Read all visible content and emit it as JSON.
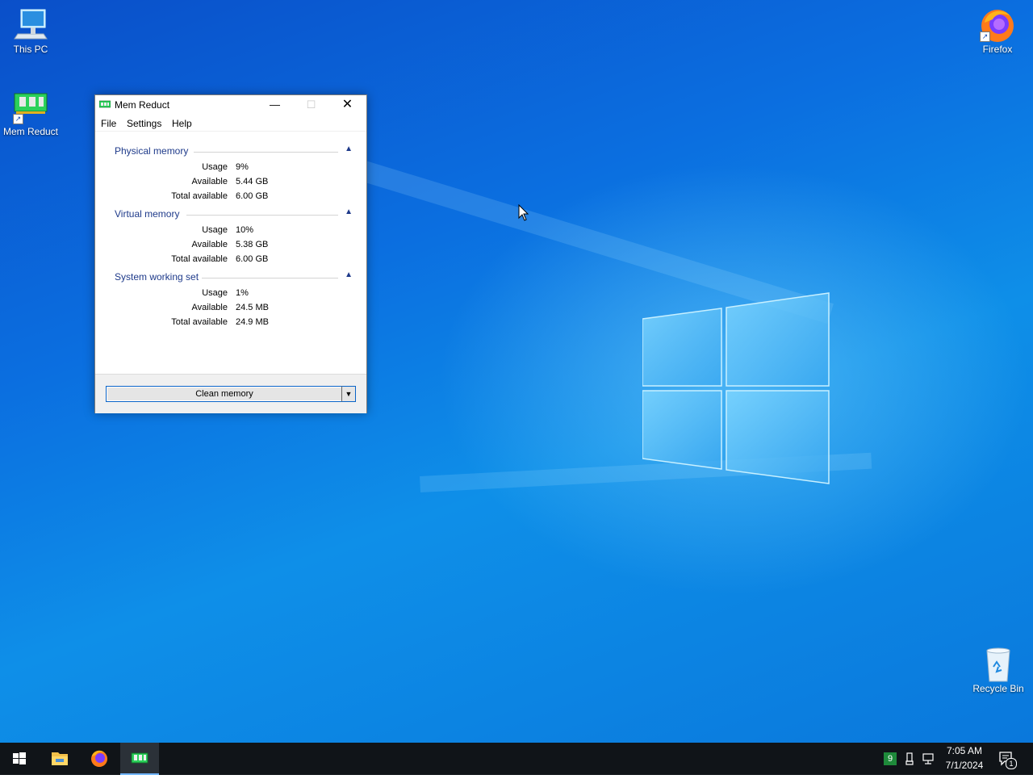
{
  "desktop": {
    "icons": {
      "this_pc": "This PC",
      "mem_reduct": "Mem Reduct",
      "firefox": "Firefox",
      "recycle_bin": "Recycle Bin"
    }
  },
  "window": {
    "title": "Mem Reduct",
    "menu": {
      "file": "File",
      "settings": "Settings",
      "help": "Help"
    },
    "groups": [
      {
        "name": "Physical memory",
        "rows": [
          {
            "label": "Usage",
            "value": "9%"
          },
          {
            "label": "Available",
            "value": "5.44 GB"
          },
          {
            "label": "Total available",
            "value": "6.00 GB"
          }
        ]
      },
      {
        "name": "Virtual memory",
        "rows": [
          {
            "label": "Usage",
            "value": "10%"
          },
          {
            "label": "Available",
            "value": "5.38 GB"
          },
          {
            "label": "Total available",
            "value": "6.00 GB"
          }
        ]
      },
      {
        "name": "System working set",
        "rows": [
          {
            "label": "Usage",
            "value": "1%"
          },
          {
            "label": "Available",
            "value": "24.5 MB"
          },
          {
            "label": "Total available",
            "value": "24.9 MB"
          }
        ]
      }
    ],
    "clean_button": "Clean memory"
  },
  "taskbar": {
    "tray_badge": "9",
    "time": "7:05 AM",
    "date": "7/1/2024",
    "notification_count": "1"
  },
  "colors": {
    "accent": "#0a64c8",
    "group_header": "#1e3a8a",
    "taskbar": "#101418"
  }
}
